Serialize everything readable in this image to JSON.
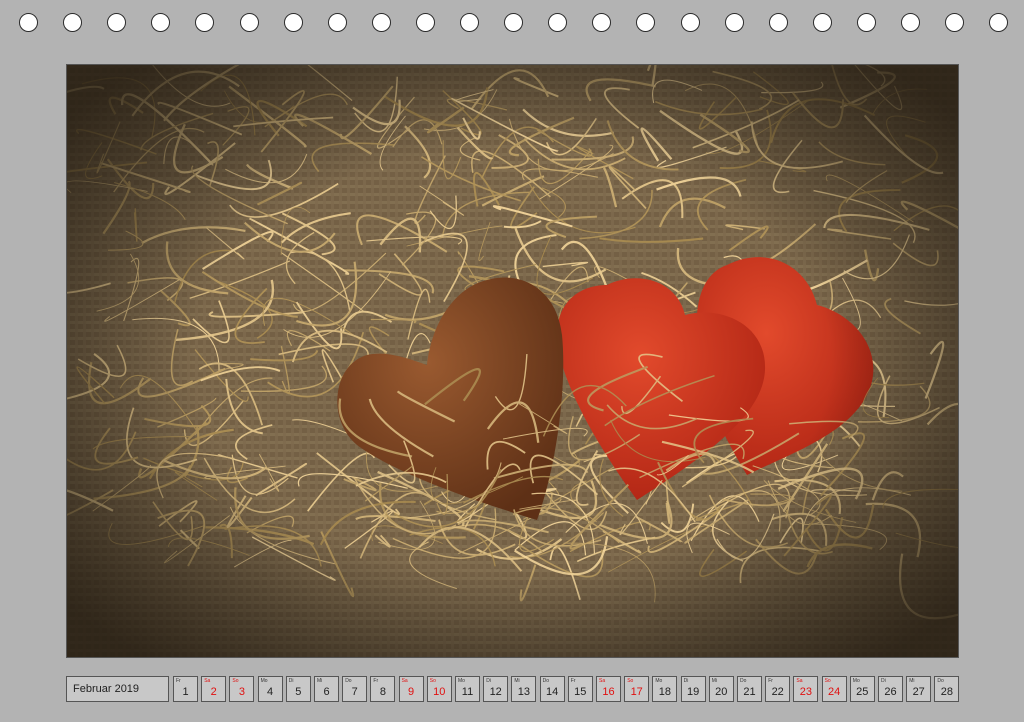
{
  "calendar": {
    "month_label": "Februar 2019",
    "days": [
      {
        "wd": "Fr",
        "num": "1",
        "weekend": false
      },
      {
        "wd": "Sa",
        "num": "2",
        "weekend": true
      },
      {
        "wd": "So",
        "num": "3",
        "weekend": true
      },
      {
        "wd": "Mo",
        "num": "4",
        "weekend": false
      },
      {
        "wd": "Di",
        "num": "5",
        "weekend": false
      },
      {
        "wd": "Mi",
        "num": "6",
        "weekend": false
      },
      {
        "wd": "Do",
        "num": "7",
        "weekend": false
      },
      {
        "wd": "Fr",
        "num": "8",
        "weekend": false
      },
      {
        "wd": "Sa",
        "num": "9",
        "weekend": true
      },
      {
        "wd": "So",
        "num": "10",
        "weekend": true
      },
      {
        "wd": "Mo",
        "num": "11",
        "weekend": false
      },
      {
        "wd": "Di",
        "num": "12",
        "weekend": false
      },
      {
        "wd": "Mi",
        "num": "13",
        "weekend": false
      },
      {
        "wd": "Do",
        "num": "14",
        "weekend": false
      },
      {
        "wd": "Fr",
        "num": "15",
        "weekend": false
      },
      {
        "wd": "Sa",
        "num": "16",
        "weekend": true
      },
      {
        "wd": "So",
        "num": "17",
        "weekend": true
      },
      {
        "wd": "Mo",
        "num": "18",
        "weekend": false
      },
      {
        "wd": "Di",
        "num": "19",
        "weekend": false
      },
      {
        "wd": "Mi",
        "num": "20",
        "weekend": false
      },
      {
        "wd": "Do",
        "num": "21",
        "weekend": false
      },
      {
        "wd": "Fr",
        "num": "22",
        "weekend": false
      },
      {
        "wd": "Sa",
        "num": "23",
        "weekend": true
      },
      {
        "wd": "So",
        "num": "24",
        "weekend": true
      },
      {
        "wd": "Mo",
        "num": "25",
        "weekend": false
      },
      {
        "wd": "Di",
        "num": "26",
        "weekend": false
      },
      {
        "wd": "Mi",
        "num": "27",
        "weekend": false
      },
      {
        "wd": "Do",
        "num": "28",
        "weekend": false
      }
    ]
  },
  "colors": {
    "page_background": "#b3b3b3",
    "weekend_text": "#e01010",
    "heart_red": "#d2321e",
    "heart_brown": "#8a4a26",
    "straw": "#c9a46a",
    "burlap": "#8c7656"
  },
  "binding": {
    "hole_count": 23
  }
}
